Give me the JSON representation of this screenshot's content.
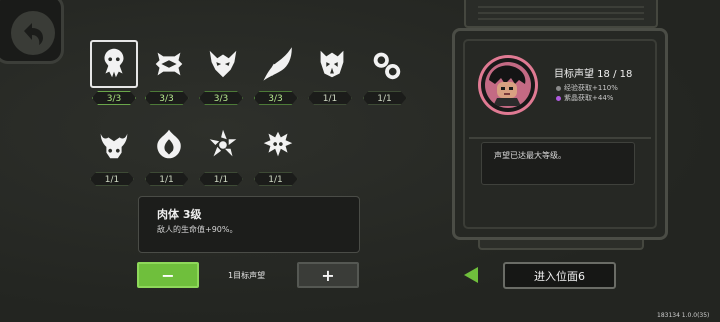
{
  "skills": [
    {
      "name": "skull-claws-icon",
      "badge": "3/3",
      "selected": true
    },
    {
      "name": "spiked-eye-icon",
      "badge": "3/3"
    },
    {
      "name": "demon-face-icon",
      "badge": "3/3"
    },
    {
      "name": "feather-wing-icon",
      "badge": "3/3"
    },
    {
      "name": "horned-mask-icon",
      "badge": "1/1"
    },
    {
      "name": "spiral-orbs-icon",
      "badge": "1/1"
    },
    {
      "name": "tentacle-skull-icon",
      "badge": "1/1"
    },
    {
      "name": "flame-crest-icon",
      "badge": "1/1"
    },
    {
      "name": "pinwheel-icon",
      "badge": "1/1"
    },
    {
      "name": "spiked-orb-icon",
      "badge": "1/1"
    }
  ],
  "detail": {
    "title": "肉体  3级",
    "text": "敌人的生命值+90%。"
  },
  "controls": {
    "minus": "−",
    "count_label": "1目标声望",
    "plus": "+"
  },
  "panel": {
    "target_title": "目标声望 18 / 18",
    "bonus_xp": "经验获取+110%",
    "bonus_purple": "紫晶获取+44%",
    "info": "声望已达最大等级。"
  },
  "colors": {
    "accent_green": "#6fbf3c",
    "avatar_ring": "#e07a93",
    "xp_dot": "#8a8a8a",
    "purple_dot": "#b05be0"
  },
  "enter_button": "进入位面6",
  "version": "183134 1.0.0(35)"
}
